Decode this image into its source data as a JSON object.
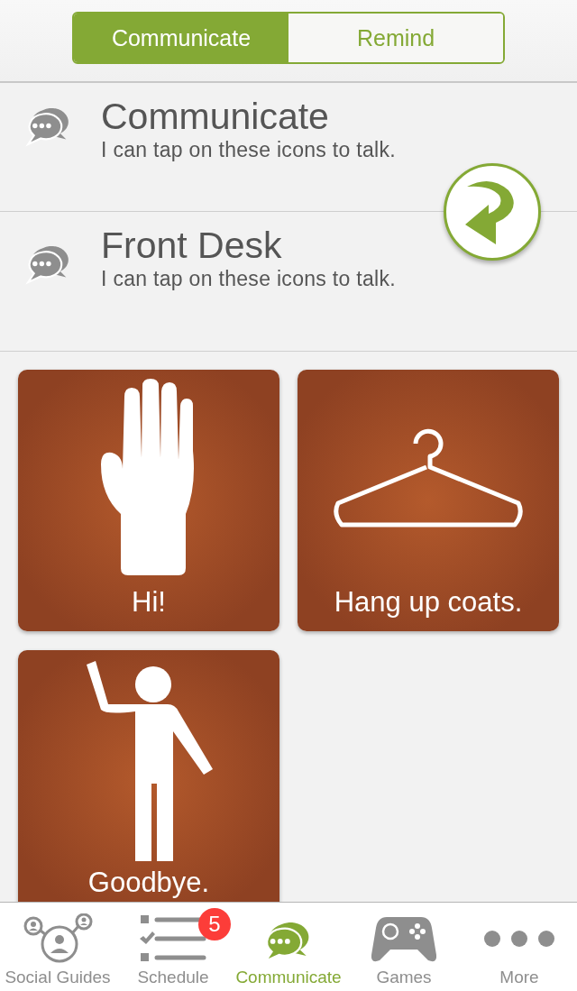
{
  "segments": [
    {
      "label": "Communicate",
      "selected": true
    },
    {
      "label": "Remind",
      "selected": false
    }
  ],
  "sections": [
    {
      "title": "Communicate",
      "subtitle": "I can tap on these icons to talk."
    },
    {
      "title": "Front Desk",
      "subtitle": "I can tap on these icons to talk."
    }
  ],
  "tiles": [
    {
      "label": "Hi!"
    },
    {
      "label": "Hang up coats."
    },
    {
      "label": "Goodbye."
    }
  ],
  "tab_bar": [
    {
      "label": "Social Guides",
      "selected": false
    },
    {
      "label": "Schedule",
      "selected": false,
      "badge": "5"
    },
    {
      "label": "Communicate",
      "selected": true
    },
    {
      "label": "Games",
      "selected": false
    },
    {
      "label": "More",
      "selected": false
    }
  ]
}
